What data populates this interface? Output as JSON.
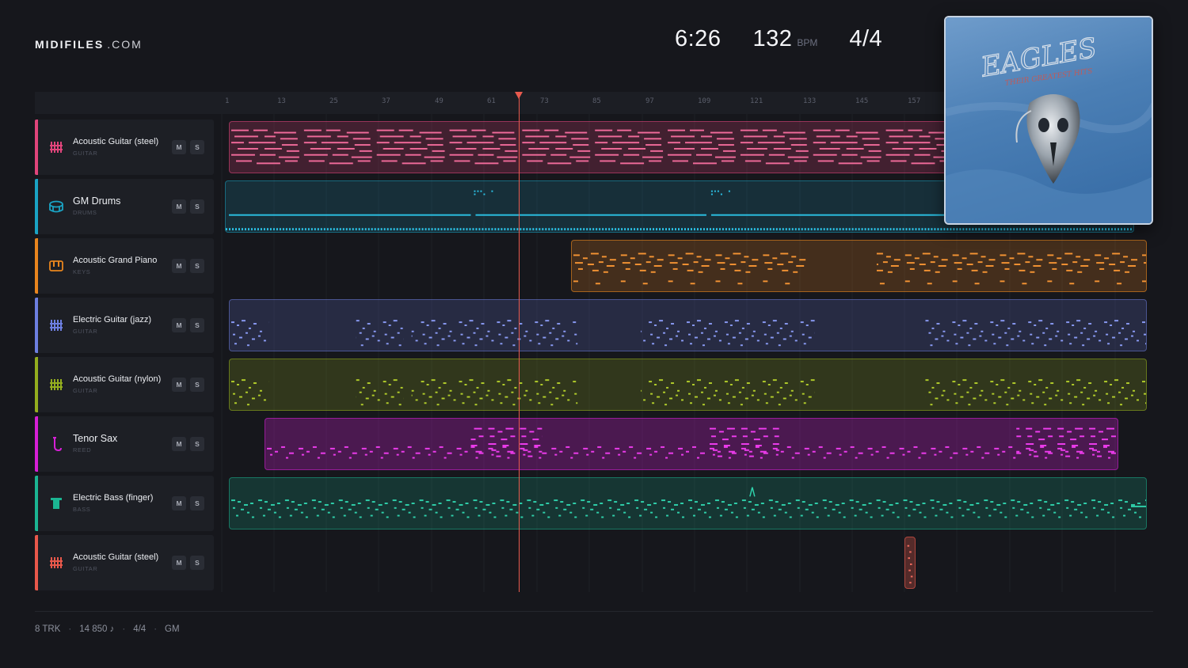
{
  "brand": {
    "name": "MIDIFILES",
    "domain": ".COM"
  },
  "stats": {
    "duration": "6:26",
    "tempo": "132",
    "tempo_unit": "BPM",
    "time_signature": "4/4"
  },
  "ruler": {
    "ticks": [
      "1",
      "13",
      "25",
      "37",
      "49",
      "61",
      "73",
      "85",
      "97",
      "109",
      "121",
      "133",
      "145",
      "157"
    ]
  },
  "cover": {
    "title_art": "EAGLES",
    "subtitle_art": "THEIR GREATEST HITS"
  },
  "tracks": [
    {
      "name": "Acoustic Guitar (steel)",
      "category": "GUITAR",
      "icon": "guitar-icon",
      "color": "#e0457b",
      "mute": "M",
      "solo": "S"
    },
    {
      "name": "GM Drums",
      "category": "DRUMS",
      "icon": "drum-icon",
      "color": "#1aa3c4",
      "mute": "M",
      "solo": "S"
    },
    {
      "name": "Acoustic Grand Piano",
      "category": "KEYS",
      "icon": "piano-icon",
      "color": "#e8851e",
      "mute": "M",
      "solo": "S"
    },
    {
      "name": "Electric Guitar (jazz)",
      "category": "GUITAR",
      "icon": "guitar-icon",
      "color": "#6d7fe0",
      "mute": "M",
      "solo": "S"
    },
    {
      "name": "Acoustic Guitar (nylon)",
      "category": "GUITAR",
      "icon": "guitar-icon",
      "color": "#93ad1e",
      "mute": "M",
      "solo": "S"
    },
    {
      "name": "Tenor Sax",
      "category": "REED",
      "icon": "sax-icon",
      "color": "#d61fd6",
      "mute": "M",
      "solo": "S"
    },
    {
      "name": "Electric Bass (finger)",
      "category": "BASS",
      "icon": "bass-icon",
      "color": "#1bb592",
      "mute": "M",
      "solo": "S"
    },
    {
      "name": "Acoustic Guitar (steel)",
      "category": "GUITAR",
      "icon": "guitar-icon",
      "color": "#e8584b",
      "mute": "M",
      "solo": "S"
    }
  ],
  "footer": {
    "tracks": "8 TRK",
    "notes": "14 850 ♪",
    "time_signature": "4/4",
    "standard": "GM"
  }
}
